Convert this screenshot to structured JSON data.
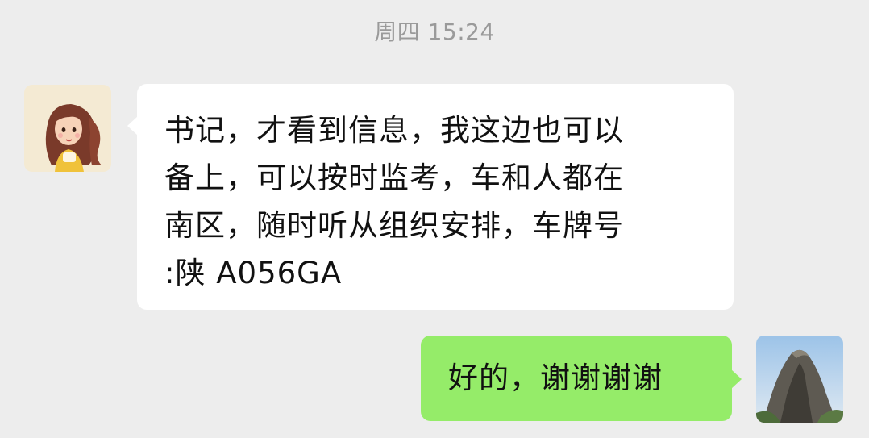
{
  "chat": {
    "timestamp": "周四 15:24",
    "messages": [
      {
        "side": "received",
        "avatar": "cartoon-girl-avatar",
        "text": "书记，才看到信息，我这边也可以\n备上，可以按时监考，车和人都在\n南区，随时听从组织安排，车牌号\n:陕 A056GA"
      },
      {
        "side": "sent",
        "avatar": "mountain-peak-avatar",
        "text": "好的，谢谢谢谢"
      }
    ]
  },
  "colors": {
    "background": "#ededed",
    "received_bubble": "#ffffff",
    "sent_bubble": "#95ec69",
    "timestamp_text": "#9a9a9a"
  }
}
